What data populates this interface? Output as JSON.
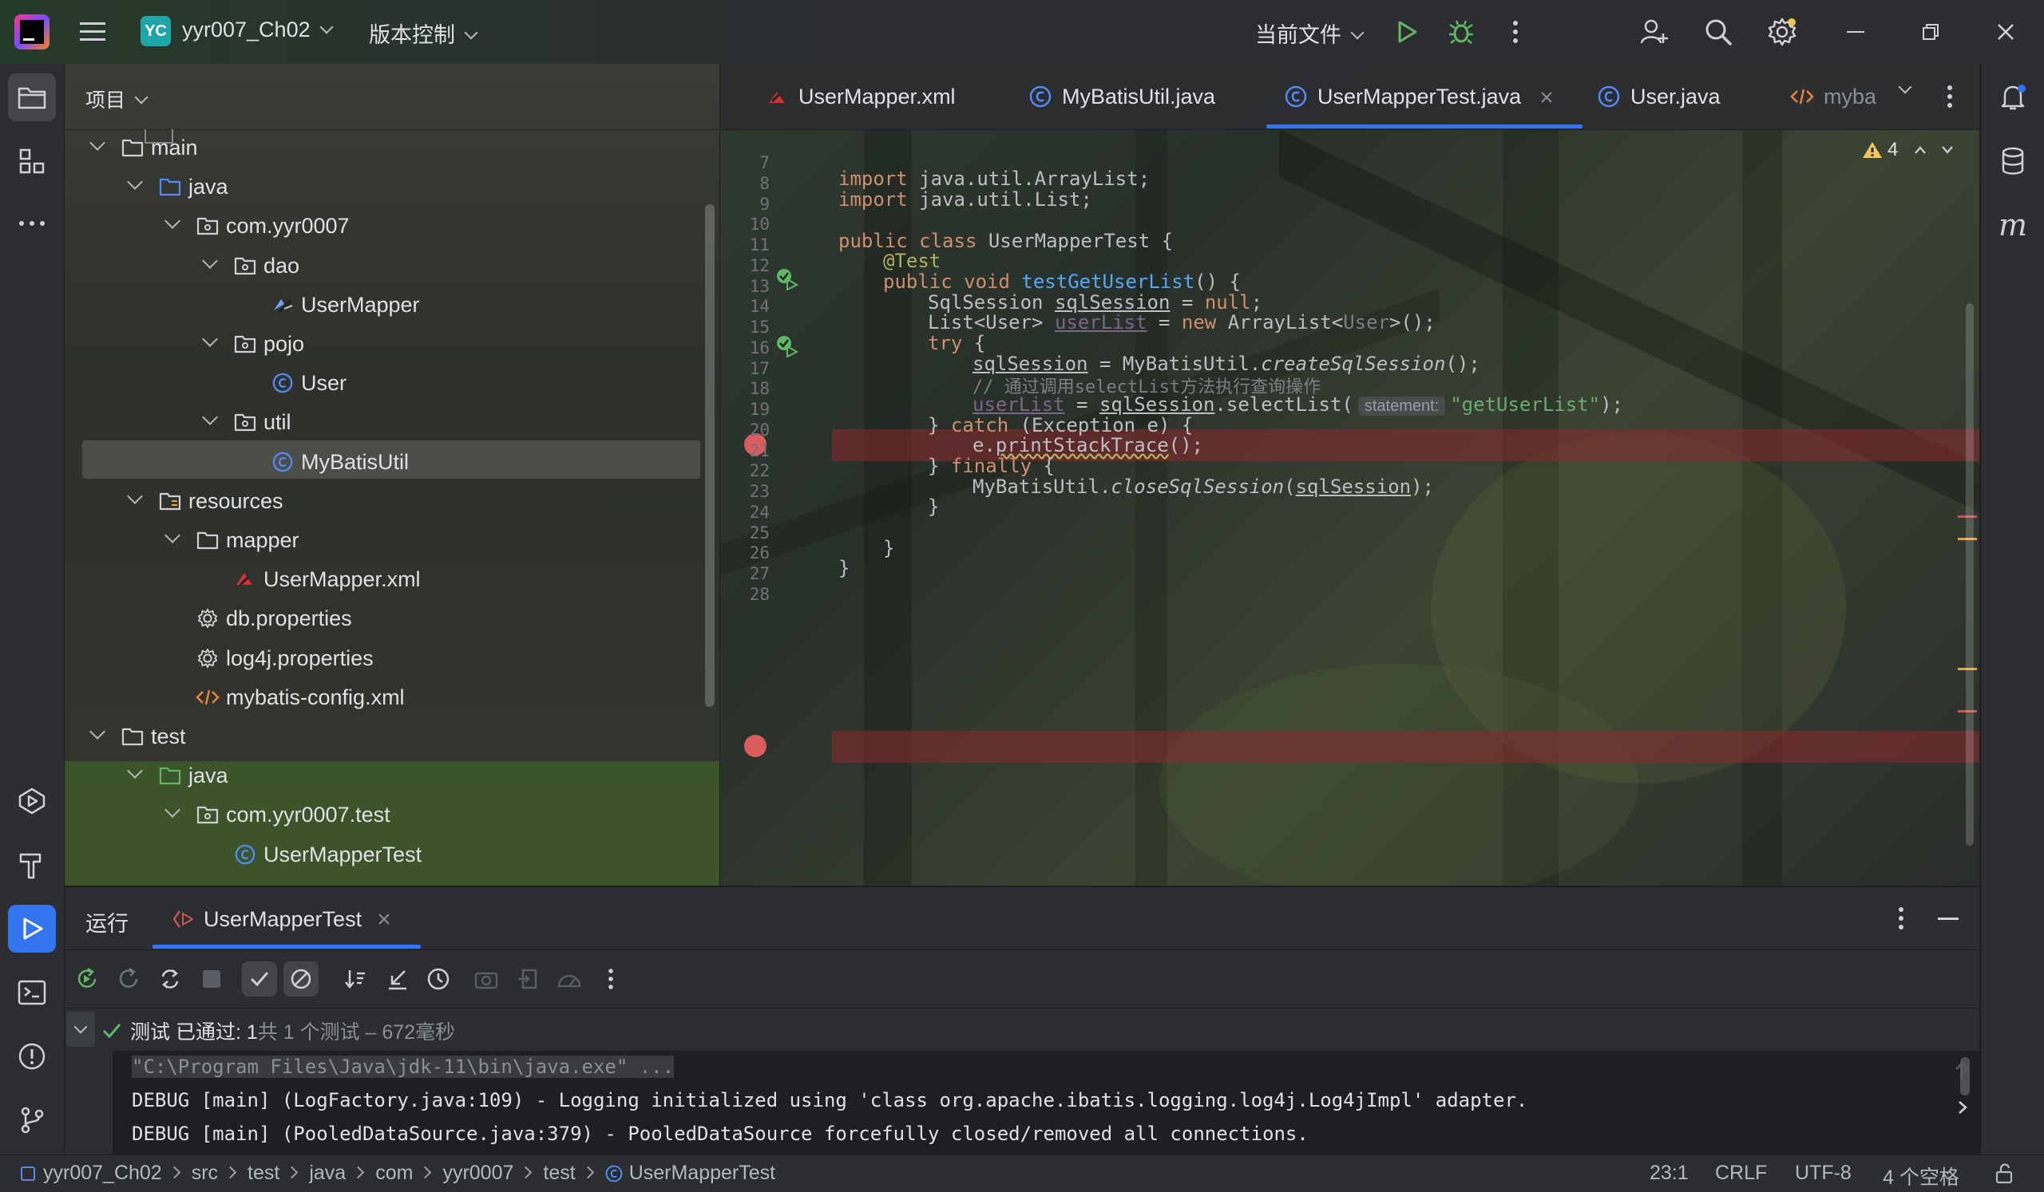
{
  "titlebar": {
    "project_badge": "YC",
    "project_name": "yyr007_Ch02",
    "vcs": "版本控制",
    "run_config": "当前文件"
  },
  "project_panel": {
    "title": "项目",
    "tree": [
      {
        "label": "main",
        "kind": "folder"
      },
      {
        "label": "java",
        "kind": "source-folder"
      },
      {
        "label": "com.yyr0007",
        "kind": "package"
      },
      {
        "label": "dao",
        "kind": "package"
      },
      {
        "label": "UserMapper",
        "kind": "mapper"
      },
      {
        "label": "pojo",
        "kind": "package"
      },
      {
        "label": "User",
        "kind": "class"
      },
      {
        "label": "util",
        "kind": "package"
      },
      {
        "label": "MyBatisUtil",
        "kind": "class"
      },
      {
        "label": "resources",
        "kind": "resource-folder"
      },
      {
        "label": "mapper",
        "kind": "folder"
      },
      {
        "label": "UserMapper.xml",
        "kind": "xml-mapper"
      },
      {
        "label": "db.properties",
        "kind": "properties"
      },
      {
        "label": "log4j.properties",
        "kind": "properties"
      },
      {
        "label": "mybatis-config.xml",
        "kind": "xml"
      },
      {
        "label": "test",
        "kind": "folder"
      },
      {
        "label": "java",
        "kind": "test-folder"
      },
      {
        "label": "com.yyr0007.test",
        "kind": "package"
      },
      {
        "label": "UserMapperTest",
        "kind": "class"
      }
    ]
  },
  "editor": {
    "tabs": [
      {
        "label": "UserMapper.xml",
        "icon": "xml-mapper-icon"
      },
      {
        "label": "MyBatisUtil.java",
        "icon": "class-icon"
      },
      {
        "label": "UserMapperTest.java",
        "icon": "class-icon",
        "active": true
      },
      {
        "label": "User.java",
        "icon": "class-icon"
      },
      {
        "label": "myba",
        "icon": "xml-icon"
      }
    ],
    "warnings_count": "4",
    "line_numbers": [
      "7",
      "8",
      "9",
      "10",
      "11",
      "12",
      "13",
      "14",
      "15",
      "16",
      "17",
      "18",
      "19",
      "20",
      "21",
      "22",
      "23",
      "24",
      "25",
      "26",
      "27",
      "28"
    ],
    "code": {
      "l8_kw": "import",
      "l8_rest": " java.util.ArrayList;",
      "l9_kw": "import",
      "l9_rest": " java.util.List;",
      "l11_kw": "public class",
      "l11_rest": " UserMapperTest {",
      "l12": "@Test",
      "l13_kw": "public void",
      "l13_fn": "testGetUserList",
      "l13_rest": "() {",
      "l14_a": "SqlSession ",
      "l14_b": "sqlSession",
      "l14_c": " = ",
      "l14_d": "null",
      "l14_e": ";",
      "l15_a": "List<User> ",
      "l15_b": "userList",
      "l15_c": " = ",
      "l15_d": "new",
      "l15_e": " ArrayList<",
      "l15_f": "User",
      "l15_g": ">();",
      "l16": "try",
      "l16_rest": " {",
      "l17_a": "sqlSession",
      "l17_b": " = MyBatisUtil.",
      "l17_c": "createSqlSession",
      "l17_d": "();",
      "l18": "// 通过调用selectList方法执行查询操作",
      "l19_a": "userList",
      "l19_b": " = ",
      "l19_c": "sqlSession",
      "l19_d": ".selectList(",
      "l19_hint": "statement:",
      "l19_str": "\"getUserList\"",
      "l19_e": ");",
      "l20_a": "} ",
      "l20_kw": "catch",
      "l20_b": " (Exception e) {",
      "l21_a": "e.",
      "l21_b": "printStackTrace",
      "l21_c": "();",
      "l22_a": "} ",
      "l22_kw": "finally",
      "l22_b": " {",
      "l23_a": "MyBatisUtil.",
      "l23_b": "closeSqlSession",
      "l23_c": "(",
      "l23_d": "sqlSession",
      "l23_e": ");",
      "l24": "}",
      "l26": "}",
      "l27": "}"
    }
  },
  "run_panel": {
    "title": "运行",
    "tab_label": "UserMapperTest",
    "tests_status": "测试 已通过: 1",
    "tests_detail": "共 1 个测试 – 672毫秒",
    "console": [
      "\"C:\\Program Files\\Java\\jdk-11\\bin\\java.exe\" ...",
      "DEBUG [main] (LogFactory.java:109) - Logging initialized using 'class org.apache.ibatis.logging.log4j.Log4jImpl' adapter.",
      "DEBUG [main] (PooledDataSource.java:379) - PooledDataSource forcefully closed/removed all connections."
    ]
  },
  "statusbar": {
    "breadcrumbs": [
      "yyr007_Ch02",
      "src",
      "test",
      "java",
      "com",
      "yyr0007",
      "test",
      "UserMapperTest"
    ],
    "position": "23:1",
    "line_sep": "CRLF",
    "encoding": "UTF-8",
    "indent": "4 个空格"
  },
  "colors": {
    "accent": "#3574f0",
    "breakpoint": "#db5c5c",
    "success": "#5fb865",
    "keyword": "#cf8e6d",
    "function": "#56a8f5",
    "string": "#6aab73"
  }
}
